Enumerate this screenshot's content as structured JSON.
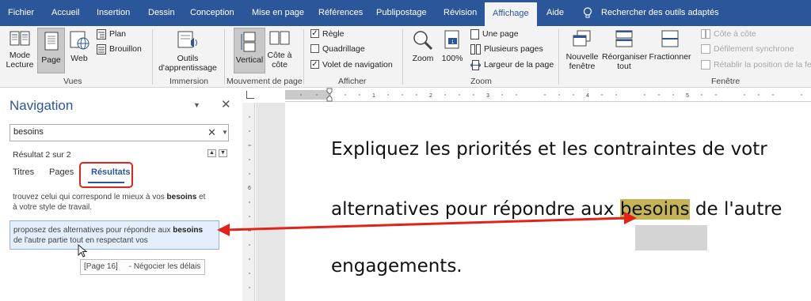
{
  "ribbon_tabs": [
    "Fichier",
    "Accueil",
    "Insertion",
    "Dessin",
    "Conception",
    "Mise en page",
    "Références",
    "Publipostage",
    "Révision",
    "Affichage",
    "Aide",
    "Rechercher des outils adaptés"
  ],
  "active_tab": "Affichage",
  "groups": {
    "vues": {
      "label": "Vues",
      "mode_lecture": "Mode Lecture",
      "page": "Page",
      "web": "Web",
      "plan": "Plan",
      "brouillon": "Brouillon"
    },
    "immersion": {
      "label": "Immersion",
      "outils": "Outils d'apprentissage"
    },
    "mouvement": {
      "label": "Mouvement de page",
      "vertical": "Vertical",
      "cote": "Côte à côte"
    },
    "afficher": {
      "label": "Afficher",
      "regle": "Règle",
      "quadrillage": "Quadrillage",
      "volet": "Volet de navigation"
    },
    "zoom": {
      "label": "Zoom",
      "zoom": "Zoom",
      "cent": "100%",
      "une_page": "Une page",
      "plusieurs": "Plusieurs pages",
      "largeur": "Largeur de la page"
    },
    "fenetre": {
      "label": "Fenêtre",
      "nouvelle": "Nouvelle fenêtre",
      "reorganiser": "Réorganiser tout",
      "fractionner": "Fractionner",
      "cote_a_cote": "Côte à côte",
      "defilement": "Défilement synchrone",
      "retablir": "Rétablir la position de la fe"
    }
  },
  "navigation": {
    "title": "Navigation",
    "search_value": "besoins",
    "result_count": "Résultat 2 sur 2",
    "tabs": {
      "titres": "Titres",
      "pages": "Pages",
      "resultats": "Résultats"
    },
    "results": [
      {
        "before": "trouvez celui qui correspond le mieux à vos ",
        "bold": "besoins",
        "after": " et",
        "line2": "à votre style de travail."
      },
      {
        "before": "proposez des alternatives pour répondre aux ",
        "bold": "besoins",
        "after": "",
        "line2": "de l'autre partie tout en respectant vos"
      }
    ],
    "tooltip": "[Page 16]     - Négocier les délais"
  },
  "document": {
    "line1": "Expliquez les priorités et les contraintes de votr",
    "line2_before": "alternatives pour répondre aux ",
    "line2_highlight": "besoins",
    "line2_after": " de l'autre",
    "line3": "engagements."
  },
  "ruler": {
    "h_ticks": [
      "1",
      "2",
      "1",
      "2",
      "3",
      "4",
      "5"
    ],
    "v_ticks": [
      "5",
      "6",
      "7"
    ]
  },
  "colors": {
    "word_blue": "#2b579a",
    "highlight": "#c5b358",
    "annotation_red": "#e2231a"
  },
  "icons": [
    "lightbulb-icon",
    "read-mode-icon",
    "page-layout-icon",
    "web-layout-icon",
    "outline-icon",
    "draft-icon",
    "learning-tools-icon",
    "vertical-icon",
    "side-by-side-icon",
    "zoom-icon",
    "hundred-percent-icon",
    "one-page-icon",
    "multiple-pages-icon",
    "page-width-icon",
    "new-window-icon",
    "arrange-all-icon",
    "split-icon",
    "close-icon",
    "chevron-down-icon",
    "clear-icon",
    "up-arrow-icon",
    "down-arrow-icon",
    "mouse-cursor-icon"
  ]
}
